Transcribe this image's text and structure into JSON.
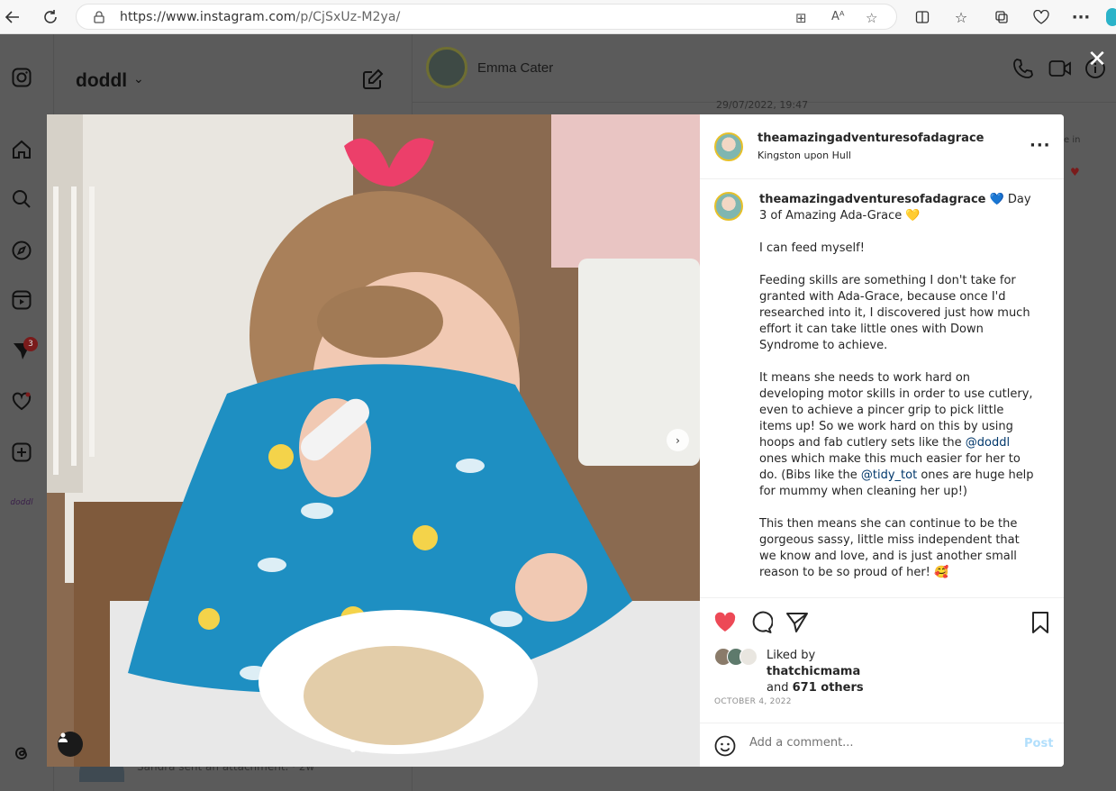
{
  "browser": {
    "url_host": "https://www.instagram.com",
    "url_path": "/p/CjSxUz-M2ya/"
  },
  "background": {
    "account_name": "doddl",
    "chat_name": "Emma Cater",
    "chat_date": "29/07/2022, 19:47",
    "notification_count": "3",
    "last_message": "Sandra sent an attachment. · 2w",
    "snippet_right": "e in"
  },
  "post": {
    "username": "theamazingadventuresofadagrace",
    "location": "Kingston upon Hull",
    "caption": {
      "line1_rest": " 💙 Day 3 of Amazing Ada-Grace 💛",
      "p2": "I can feed myself!",
      "p3": "Feeding skills are something I don't take for granted with Ada-Grace, because once I'd researched into it, I discovered just how much effort it can take little ones with Down Syndrome to achieve.",
      "p4_a": "It means she needs to work hard on developing motor skills in order to use cutlery, even to achieve a pincer grip to pick little items up! So we work hard on this by using hoops and fab cutlery sets like the ",
      "p4_mention1": "@doddl",
      "p4_b": " ones which make this much easier for her to do. (Bibs like the ",
      "p4_mention2": "@tidy_tot",
      "p4_c": " ones are huge help for mummy when cleaning her up!)",
      "p5": "This then means she can continue to be the gorgeous sassy, little miss independent that we know and love, and is just another small reason to be so proud of her! 🥰"
    },
    "likes": {
      "prefix": "Liked by",
      "user": "thatchicmama",
      "and": "and",
      "others": "671 others"
    },
    "date": "OCTOBER 4, 2022",
    "comment_placeholder": "Add a comment...",
    "post_label": "Post",
    "slide_count": 5,
    "active_slide": 1,
    "liked": true,
    "colors": {
      "heart": "#ed4956",
      "mention": "#00376b",
      "post_disabled": "#b2dffc"
    }
  },
  "icons": {
    "sidebar": [
      "instagram-logo-icon",
      "home-icon",
      "search-icon",
      "explore-icon",
      "reels-icon",
      "messages-icon",
      "notifications-icon",
      "create-icon",
      "profile-avatar",
      "threads-icon"
    ]
  }
}
